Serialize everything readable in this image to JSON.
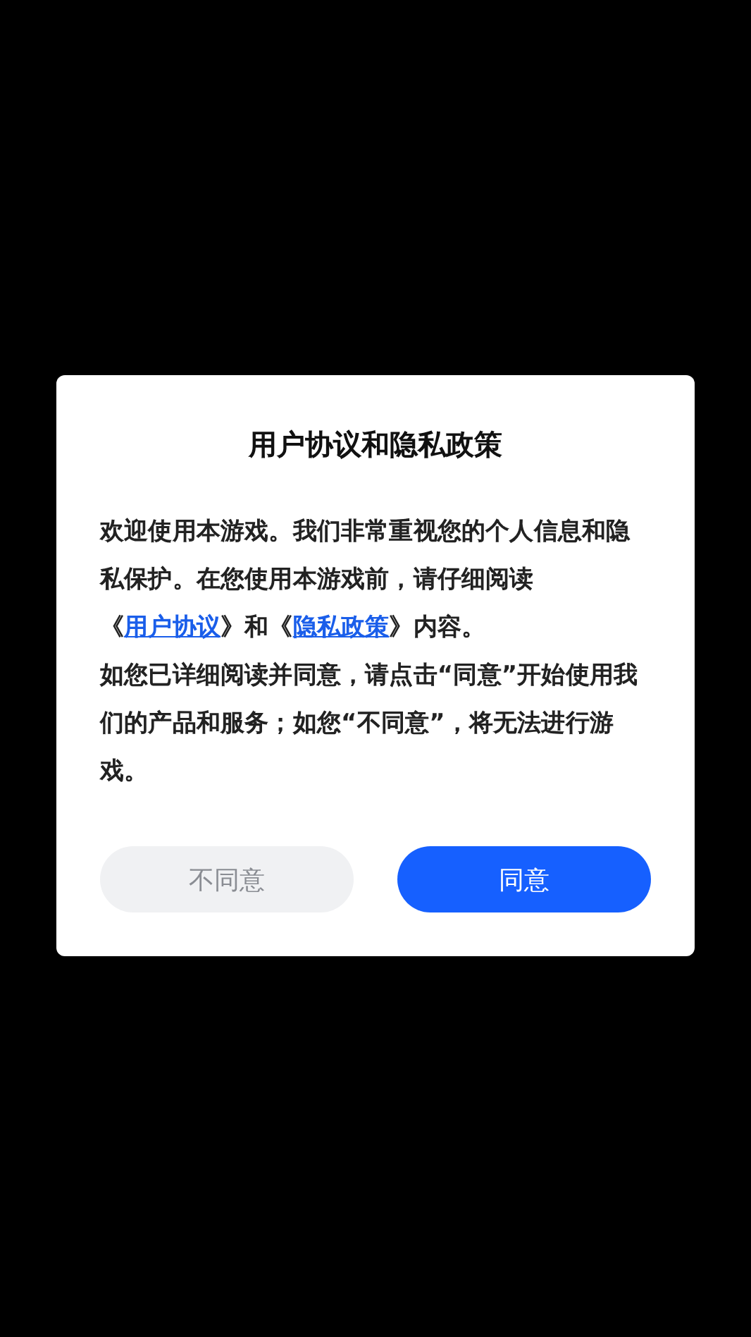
{
  "dialog": {
    "title": "用户协议和隐私政策",
    "paragraphs": [
      [
        {
          "kind": "text",
          "text": "欢迎使用本游戏。我们非常重视您的个人信息和隐私保护。在您使用本游戏前，请仔细阅读《"
        },
        {
          "kind": "link",
          "text": "用户协议"
        },
        {
          "kind": "text",
          "text": "》和《"
        },
        {
          "kind": "link",
          "text": "隐私政策"
        },
        {
          "kind": "text",
          "text": "》内容。"
        }
      ],
      [
        {
          "kind": "text",
          "text": "如您已详细阅读并同意，请点击“同意”开始使用我们的产品和服务；如您“不同意”，将无法进行游戏。"
        }
      ]
    ],
    "buttons": [
      {
        "label": "不同意",
        "kind": "secondary"
      },
      {
        "label": "同意",
        "kind": "primary"
      }
    ]
  }
}
